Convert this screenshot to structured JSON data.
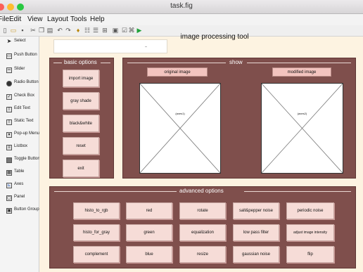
{
  "window": {
    "title": "task.fig"
  },
  "menu": {
    "items": [
      "File",
      "Edit",
      "View",
      "Layout",
      "Tools",
      "Help"
    ]
  },
  "toolbar": {
    "icons": [
      "new-icon",
      "open-icon",
      "save-icon",
      "cut-icon",
      "copy-icon",
      "paste-icon",
      "undo-icon",
      "redo-icon",
      "align-icon",
      "tab-order-icon",
      "editor-icon",
      "property-inspector-icon",
      "object-browser-icon",
      "menu-editor-icon",
      "run-icon"
    ]
  },
  "palette": {
    "items": [
      {
        "label": "Select",
        "icon": "pointer-icon"
      },
      {
        "label": "Push Button",
        "icon": "push-button-icon"
      },
      {
        "label": "Slider",
        "icon": "slider-icon"
      },
      {
        "label": "Radio Button",
        "icon": "radio-button-icon"
      },
      {
        "label": "Check Box",
        "icon": "check-box-icon"
      },
      {
        "label": "Edit Text",
        "icon": "edit-text-icon"
      },
      {
        "label": "Static Text",
        "icon": "static-text-icon"
      },
      {
        "label": "Pop-up Menu",
        "icon": "popup-menu-icon"
      },
      {
        "label": "Listbox",
        "icon": "listbox-icon"
      },
      {
        "label": "Toggle Button",
        "icon": "toggle-button-icon"
      },
      {
        "label": "Table",
        "icon": "table-icon"
      },
      {
        "label": "Axes",
        "icon": "axes-icon"
      },
      {
        "label": "Panel",
        "icon": "panel-icon"
      },
      {
        "label": "Button Group",
        "icon": "button-group-icon"
      }
    ]
  },
  "app": {
    "title": "image processing tool",
    "basic_options": {
      "title": "basic options",
      "buttons": [
        "import image",
        "gray shade",
        "black&white",
        "reset",
        "exit"
      ]
    },
    "show": {
      "title": "show",
      "original_label": "original image",
      "modified_label": "modified image",
      "original_axes_text": "(axes1)",
      "modified_axes_text": "(axes2)"
    },
    "advanced_options": {
      "title": "advanced options",
      "buttons": [
        "histo_to_rgb",
        "red",
        "rotate",
        "salt&pepper noise",
        "periodic noise",
        "histo_for_gray",
        "green",
        "equalization",
        "low pass filter",
        "adjust image intensity",
        "complement",
        "blue",
        "resize",
        "gaussian noise",
        "flip"
      ]
    }
  },
  "colors": {
    "panel": "#7f4f4c",
    "button": "#f6dcd7",
    "canvas": "#fdf3e1",
    "label": "#f3c4bf"
  }
}
